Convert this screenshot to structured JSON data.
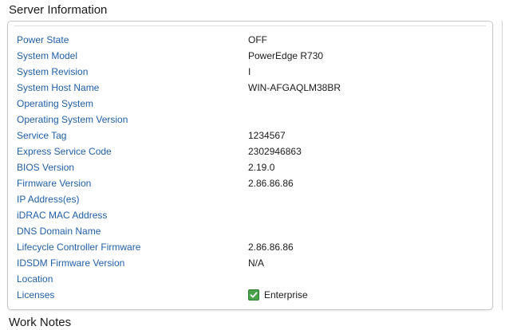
{
  "section": {
    "title": "Server Information",
    "next_title": "Work Notes"
  },
  "rows": [
    {
      "label": "Power State",
      "value": "OFF"
    },
    {
      "label": "System Model",
      "value": "PowerEdge R730"
    },
    {
      "label": "System Revision",
      "value": "I"
    },
    {
      "label": "System Host Name",
      "value": "WIN-AFGAQLM38BR"
    },
    {
      "label": "Operating System",
      "value": ""
    },
    {
      "label": "Operating System Version",
      "value": ""
    },
    {
      "label": "Service Tag",
      "value": "1234567"
    },
    {
      "label": "Express Service Code",
      "value": "2302946863"
    },
    {
      "label": "BIOS Version",
      "value": "2.19.0"
    },
    {
      "label": "Firmware Version",
      "value": "2.86.86.86"
    },
    {
      "label": "IP Address(es)",
      "value": ""
    },
    {
      "label": "iDRAC MAC Address",
      "value": ""
    },
    {
      "label": "DNS Domain Name",
      "value": ""
    },
    {
      "label": "Lifecycle Controller Firmware",
      "value": "2.86.86.86"
    },
    {
      "label": "IDSDM Firmware Version",
      "value": "N/A"
    },
    {
      "label": "Location",
      "value": ""
    },
    {
      "label": "Licenses",
      "value": "Enterprise",
      "icon": "check-icon"
    }
  ],
  "colors": {
    "label": "#1f5ea8",
    "value": "#1a1a1a",
    "check": "#4aa24a"
  }
}
